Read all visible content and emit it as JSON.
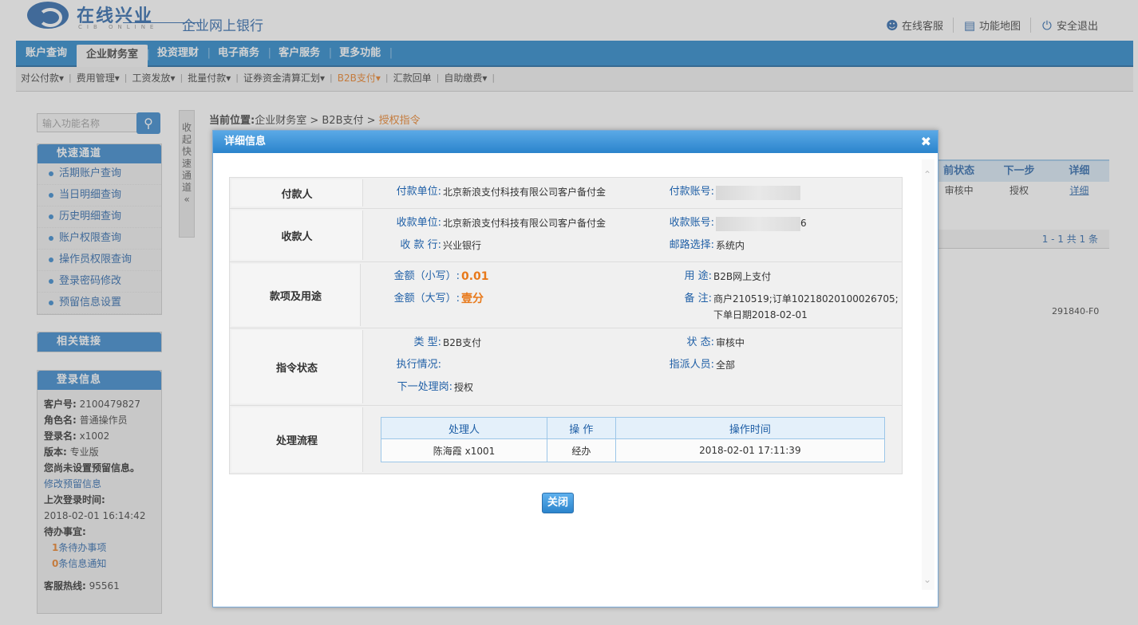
{
  "header": {
    "logo_cn": "在线兴业",
    "logo_en": "CIB ONLINE",
    "subtitle": "企业网上银行",
    "links": [
      "在线客服",
      "功能地图",
      "安全退出"
    ]
  },
  "nav": {
    "items": [
      "账户查询",
      "企业财务室",
      "投资理财",
      "电子商务",
      "客户服务",
      "更多功能"
    ],
    "active": 1
  },
  "subnav": {
    "items": [
      "对公付款▾",
      "费用管理▾",
      "工资发放▾",
      "批量付款▾",
      "证券资金清算汇划▾",
      "B2B支付▾",
      "汇款回单",
      "自助缴费▾"
    ]
  },
  "sidebar": {
    "search_placeholder": "输入功能名称",
    "quick_title": "快速通道",
    "quick_items": [
      "活期账户查询",
      "当日明细查询",
      "历史明细查询",
      "账户权限查询",
      "操作员权限查询",
      "登录密码修改",
      "预留信息设置"
    ],
    "links_title": "相关链接",
    "login_title": "登录信息",
    "customer_no_label": "客户号:",
    "customer_no": "2100479827",
    "role_label": "角色名:",
    "role": "普通操作员",
    "login_name_label": "登录名:",
    "login_name": "x1002",
    "version_label": "版本:",
    "version": "专业版",
    "no_reserved": "您尚未设置预留信息。",
    "modify_reserved": "修改预留信息",
    "last_login_label": "上次登录时间:",
    "last_login": "2018-02-01 16:14:42",
    "todo_label": "待办事宜:",
    "todo_count": "1",
    "todo_text": "条待办事项",
    "notice_count": "0",
    "notice_text": "条信息通知",
    "hotline_label": "客服热线:",
    "hotline": "95561"
  },
  "collapse_text": "收起快速通道",
  "breadcrumb": {
    "label": "当前位置:",
    "path1": "企业财务室",
    "path2": "B2B支付",
    "current": "授权指令"
  },
  "bg_table": {
    "headers": [
      "前状态",
      "下一步",
      "详细"
    ],
    "row": [
      "审核中",
      "授权",
      "详细"
    ],
    "footer": "1 - 1  共 1 条",
    "code": "291840-F0"
  },
  "modal": {
    "title": "详细信息",
    "close_label": "关闭",
    "payer": {
      "label": "付款人",
      "unit_label": "付款单位:",
      "unit": "北京新浪支付科技有限公司客户备付金",
      "account_label": "付款账号:"
    },
    "payee": {
      "label": "收款人",
      "unit_label": "收款单位:",
      "unit": "北京新浪支付科技有限公司客户备付金",
      "account_label": "收款账号:",
      "account_tail": "6",
      "bank_label": "收  款 行:",
      "bank": "兴业银行",
      "route_label": "邮路选择:",
      "route": "系统内"
    },
    "purpose": {
      "label": "款项及用途",
      "amt_small_label": "金额（小写）:",
      "amt_small": "0.01",
      "amt_big_label": "金额（大写）:",
      "amt_big": "壹分",
      "use_label": "用      途:",
      "use": "B2B网上支付",
      "note_label": "备      注:",
      "note": "商户210519;订单10218020100026705;下单日期2018-02-01"
    },
    "status": {
      "label": "指令状态",
      "type_label": "类      型:",
      "type": "B2B支付",
      "state_label": "状      态:",
      "state": "审核中",
      "exec_label": "执行情况:",
      "exec": "",
      "assign_label": "指派人员:",
      "assign": "全部",
      "next_label": "下一处理岗:",
      "next": "授权"
    },
    "flow": {
      "label": "处理流程",
      "headers": [
        "处理人",
        "操      作",
        "操作时间"
      ],
      "rows": [
        [
          "陈海霞 x1001",
          "经办",
          "2018-02-01 17:11:39"
        ]
      ]
    }
  }
}
